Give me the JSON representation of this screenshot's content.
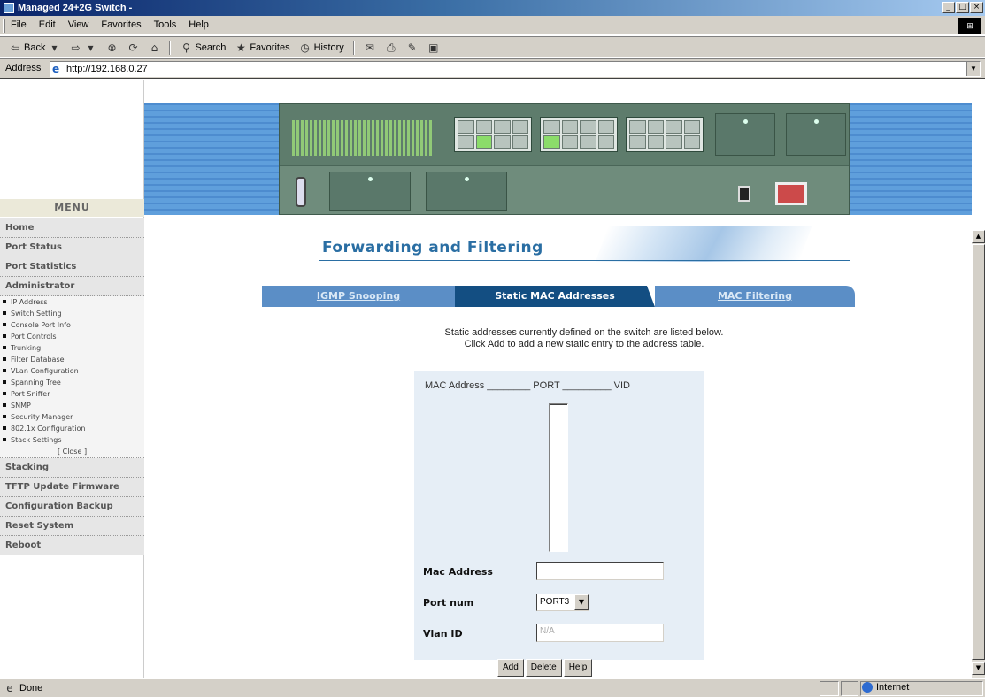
{
  "window": {
    "title": "Managed 24+2G Switch -"
  },
  "menubar": {
    "items": [
      "File",
      "Edit",
      "View",
      "Favorites",
      "Tools",
      "Help"
    ]
  },
  "toolbar": {
    "back": "Back",
    "search": "Search",
    "favorites": "Favorites",
    "history": "History"
  },
  "address": {
    "label": "Address",
    "url": "http://192.168.0.27"
  },
  "leftmenu": {
    "header": "MENU",
    "top_items": [
      "Home",
      "Port Status",
      "Port Statistics",
      "Administrator"
    ],
    "sub_items": [
      "IP Address",
      "Switch Setting",
      "Console Port Info",
      "Port Controls",
      "Trunking",
      "Filter Database",
      "VLan Configuration",
      "Spanning Tree",
      "Port Sniffer",
      "SNMP",
      "Security Manager",
      "802.1x Configuration",
      "Stack Settings"
    ],
    "close": "[ Close ]",
    "bottom_items": [
      "Stacking",
      "TFTP Update Firmware",
      "Configuration Backup",
      "Reset System",
      "Reboot"
    ]
  },
  "page": {
    "title": "Forwarding and Filtering",
    "tabs": [
      "IGMP Snooping",
      "Static MAC Addresses",
      "MAC Filtering"
    ],
    "desc_line1": "Static addresses currently defined on the switch are listed below.",
    "desc_line2": "Click Add to add a new static entry to the address table.",
    "columns": "MAC Address ________ PORT _________ VID",
    "form": {
      "mac_label": "Mac Address",
      "mac_value": "",
      "port_label": "Port num",
      "port_value": "PORT3",
      "vlan_label": "Vlan ID",
      "vlan_value": "N/A"
    },
    "buttons": {
      "add": "Add",
      "delete": "Delete",
      "help": "Help"
    }
  },
  "status": {
    "text": "Done",
    "zone": "Internet"
  }
}
